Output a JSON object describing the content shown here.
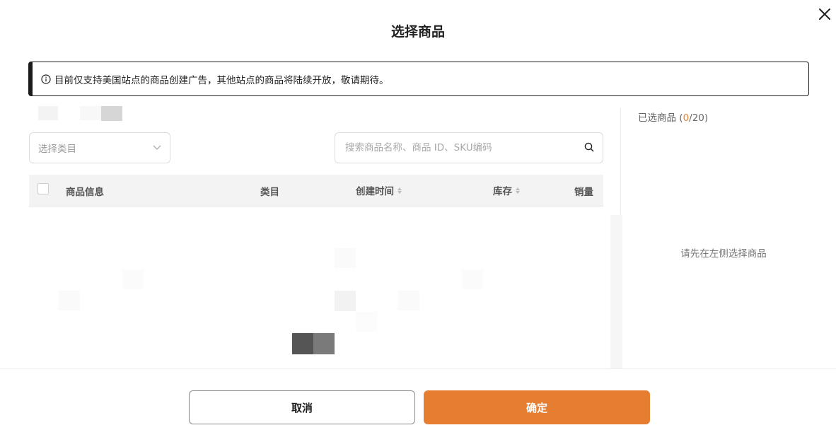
{
  "dialog": {
    "title": "选择商品"
  },
  "notice": {
    "text": "目前仅支持美国站点的商品创建广告，其他站点的商品将陆续开放，敬请期待。"
  },
  "filters": {
    "category_placeholder": "选择类目",
    "search_placeholder": "搜索商品名称、商品 ID、SKU编码"
  },
  "table": {
    "columns": {
      "product_info": "商品信息",
      "category": "类目",
      "created_time": "创建时间",
      "stock": "库存",
      "sales": "销量"
    }
  },
  "selected_panel": {
    "label": "已选商品",
    "open_paren": " (",
    "count": "0",
    "total": "/20)",
    "empty_hint": "请先在左侧选择商品"
  },
  "footer": {
    "cancel_label": "取消",
    "confirm_label": "确定"
  },
  "colors": {
    "accent": "#e67e32",
    "notice_border": "#1b1b1b"
  },
  "icons": [
    "close-icon",
    "info-icon",
    "chevron-down-icon",
    "search-icon",
    "sort-icon"
  ]
}
